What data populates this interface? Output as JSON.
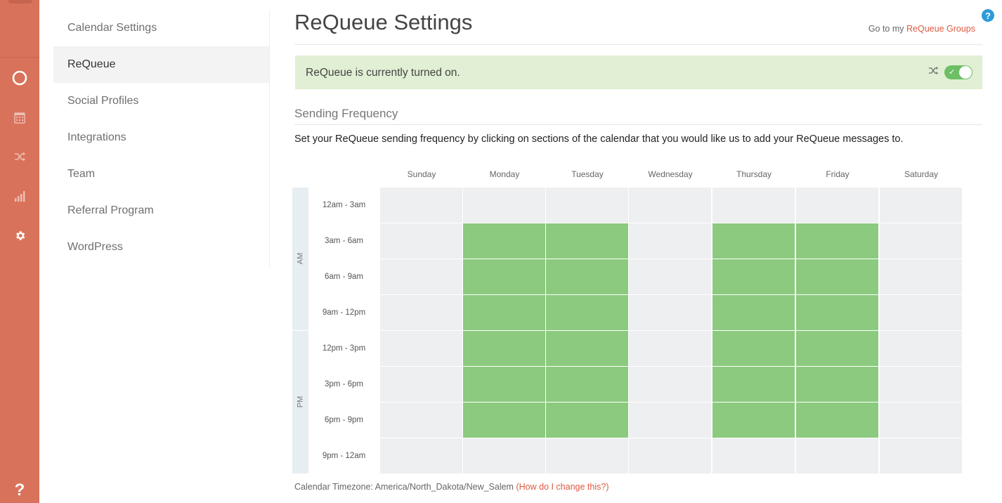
{
  "rail": {
    "icons": [
      "circle-icon",
      "calendar-icon",
      "shuffle-icon",
      "analytics-icon",
      "gear-icon",
      "help-icon"
    ],
    "help_glyph": "?"
  },
  "nav": {
    "items": [
      {
        "label": "Calendar Settings",
        "active": false
      },
      {
        "label": "ReQueue",
        "active": true
      },
      {
        "label": "Social Profiles",
        "active": false
      },
      {
        "label": "Integrations",
        "active": false
      },
      {
        "label": "Team",
        "active": false
      },
      {
        "label": "Referral Program",
        "active": false
      },
      {
        "label": "WordPress",
        "active": false
      }
    ]
  },
  "header": {
    "title": "ReQueue Settings",
    "groups_prefix": "Go to my",
    "groups_link": "ReQueue Groups",
    "help_badge": "?"
  },
  "status": {
    "text": "ReQueue is currently turned on.",
    "toggle_on": true,
    "toggle_check": "✓"
  },
  "frequency": {
    "title": "Sending Frequency",
    "description": "Set your ReQueue sending frequency by clicking on sections of the calendar that you would like us to add your ReQueue messages to.",
    "days": [
      "Sunday",
      "Monday",
      "Tuesday",
      "Wednesday",
      "Thursday",
      "Friday",
      "Saturday"
    ],
    "periods": [
      "AM",
      "PM"
    ],
    "slots": [
      "12am - 3am",
      "3am - 6am",
      "6am - 9am",
      "9am - 12pm",
      "12pm - 3pm",
      "3pm - 6pm",
      "6pm - 9pm",
      "9pm - 12am"
    ],
    "selected": [
      [
        false,
        false,
        false,
        false,
        false,
        false,
        false
      ],
      [
        false,
        true,
        true,
        false,
        true,
        true,
        false
      ],
      [
        false,
        true,
        true,
        false,
        true,
        true,
        false
      ],
      [
        false,
        true,
        true,
        false,
        true,
        true,
        false
      ],
      [
        false,
        true,
        true,
        false,
        true,
        true,
        false
      ],
      [
        false,
        true,
        true,
        false,
        true,
        true,
        false
      ],
      [
        false,
        true,
        true,
        false,
        true,
        true,
        false
      ],
      [
        false,
        false,
        false,
        false,
        false,
        false,
        false
      ]
    ],
    "colors": {
      "selected": "#8bca7f",
      "unselected": "#eeeff0"
    }
  },
  "timezone": {
    "prefix": "Calendar Timezone:",
    "value": "America/North_Dakota/New_Salem",
    "help_link": "(How do I change this?)"
  },
  "colors": {
    "rail": "#d9725a",
    "accent_link": "#dd5a41",
    "status_bg": "#e1efd4",
    "toggle": "#6cbf64"
  }
}
